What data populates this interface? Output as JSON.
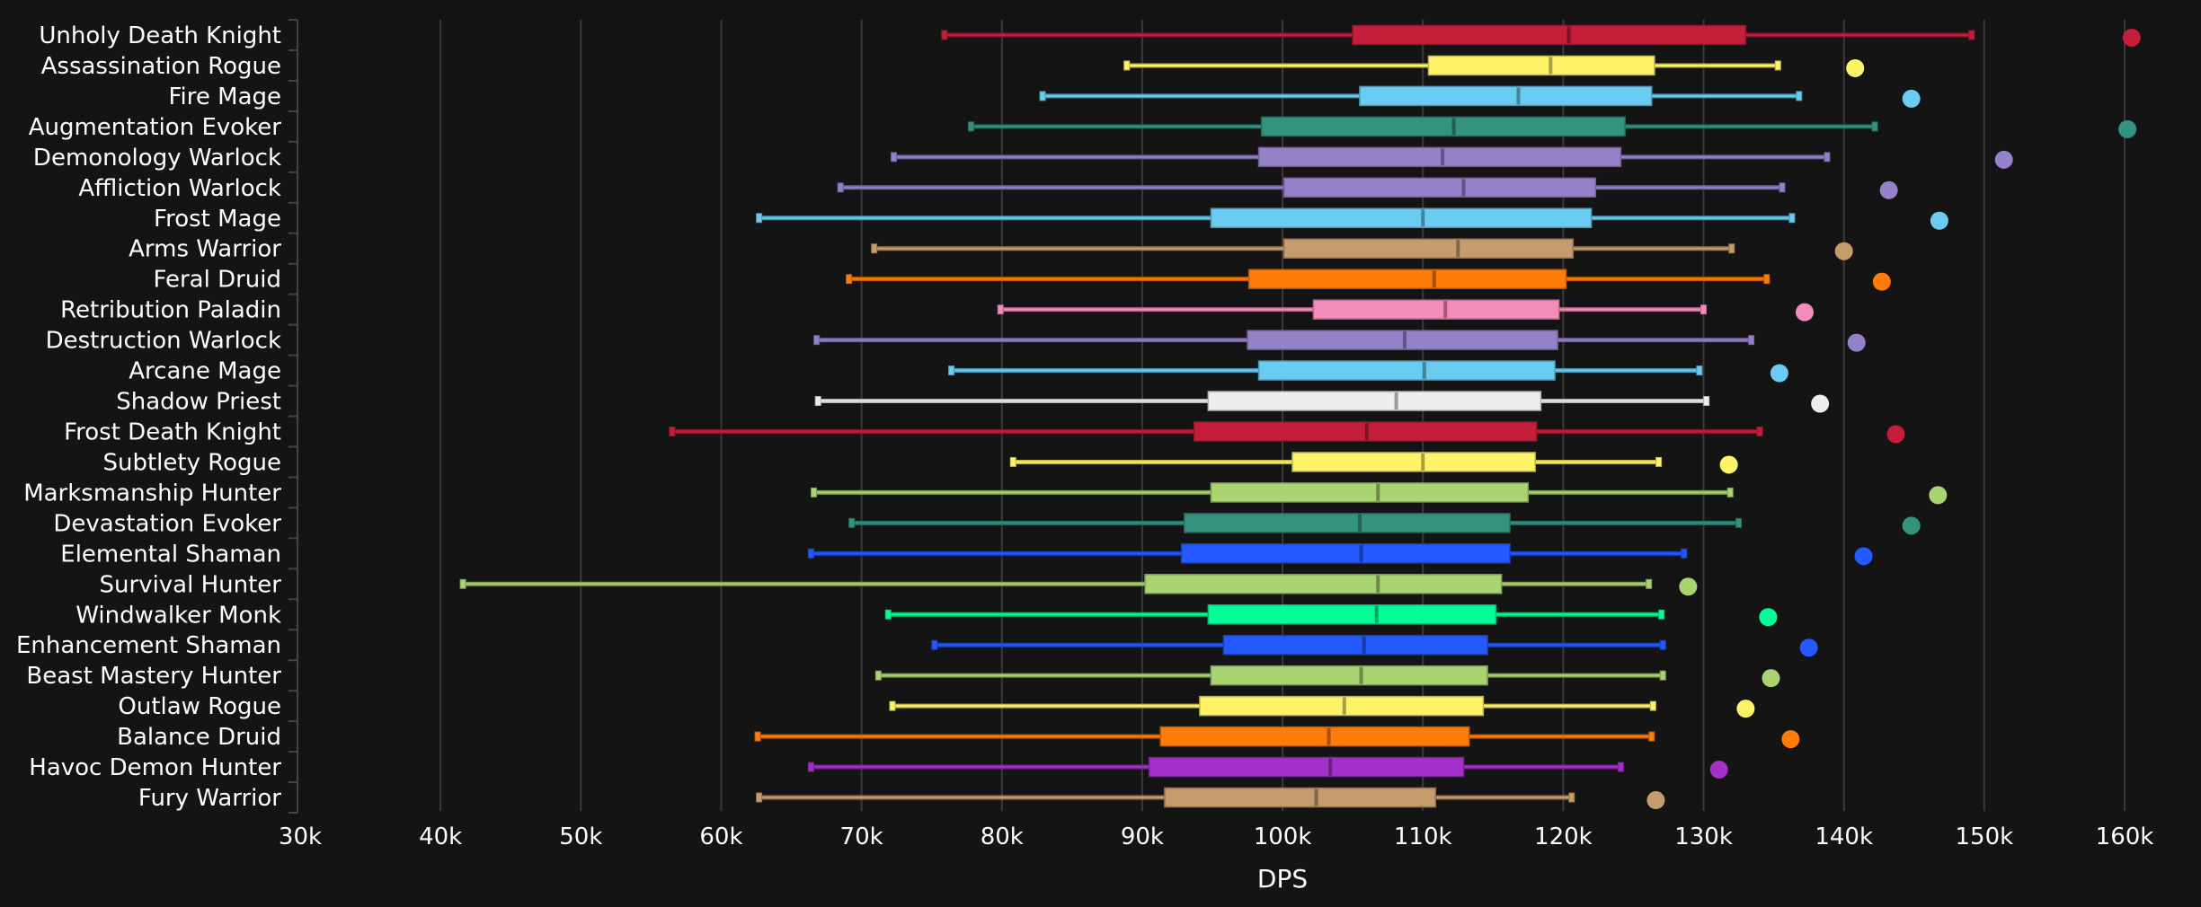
{
  "chart_data": {
    "type": "boxplot",
    "title": "",
    "xlabel": "DPS",
    "ylabel": "",
    "xlim": [
      30000,
      160000
    ],
    "x_ticks": [
      30000,
      40000,
      50000,
      60000,
      70000,
      80000,
      90000,
      100000,
      110000,
      120000,
      130000,
      140000,
      150000,
      160000
    ],
    "x_tick_labels": [
      "30k",
      "40k",
      "50k",
      "60k",
      "70k",
      "80k",
      "90k",
      "100k",
      "110k",
      "120k",
      "130k",
      "140k",
      "150k",
      "160k"
    ],
    "grid": "vertical",
    "legend": "none",
    "series": [
      {
        "name": "Unholy Death Knight",
        "color": "#C41E3A",
        "whisker_low": 75900,
        "q1": 105000,
        "median": 120400,
        "q3": 133000,
        "whisker_high": 149100,
        "outlier": 160500
      },
      {
        "name": "Assassination Rogue",
        "color": "#FFF468",
        "whisker_low": 88900,
        "q1": 110400,
        "median": 119100,
        "q3": 126500,
        "whisker_high": 135300,
        "outlier": 140800
      },
      {
        "name": "Fire Mage",
        "color": "#69CCF0",
        "whisker_low": 82900,
        "q1": 105500,
        "median": 116800,
        "q3": 126300,
        "whisker_high": 136800,
        "outlier": 144800
      },
      {
        "name": "Augmentation Evoker",
        "color": "#33937F",
        "whisker_low": 77800,
        "q1": 98500,
        "median": 112200,
        "q3": 124400,
        "whisker_high": 142200,
        "outlier": 160200
      },
      {
        "name": "Demonology Warlock",
        "color": "#9482C9",
        "whisker_low": 72300,
        "q1": 98300,
        "median": 111400,
        "q3": 124100,
        "whisker_high": 138800,
        "outlier": 151400
      },
      {
        "name": "Affliction Warlock",
        "color": "#9482C9",
        "whisker_low": 68500,
        "q1": 100100,
        "median": 112900,
        "q3": 122300,
        "whisker_high": 135600,
        "outlier": 143200
      },
      {
        "name": "Frost Mage",
        "color": "#69CCF0",
        "whisker_low": 62700,
        "q1": 94900,
        "median": 110000,
        "q3": 122000,
        "whisker_high": 136300,
        "outlier": 146800
      },
      {
        "name": "Arms Warrior",
        "color": "#C69B6D",
        "whisker_low": 70900,
        "q1": 100100,
        "median": 112500,
        "q3": 120700,
        "whisker_high": 132000,
        "outlier": 140000
      },
      {
        "name": "Feral Druid",
        "color": "#FF7C0A",
        "whisker_low": 69100,
        "q1": 97600,
        "median": 110800,
        "q3": 120200,
        "whisker_high": 134500,
        "outlier": 142700
      },
      {
        "name": "Retribution Paladin",
        "color": "#F48CBA",
        "whisker_low": 79900,
        "q1": 102200,
        "median": 111600,
        "q3": 119700,
        "whisker_high": 130000,
        "outlier": 137200
      },
      {
        "name": "Destruction Warlock",
        "color": "#9482C9",
        "whisker_low": 66800,
        "q1": 97500,
        "median": 108700,
        "q3": 119600,
        "whisker_high": 133400,
        "outlier": 140900
      },
      {
        "name": "Arcane Mage",
        "color": "#69CCF0",
        "whisker_low": 76400,
        "q1": 98300,
        "median": 110100,
        "q3": 119400,
        "whisker_high": 129700,
        "outlier": 135400
      },
      {
        "name": "Shadow Priest",
        "color": "#EEEEEE",
        "whisker_low": 66900,
        "q1": 94700,
        "median": 108100,
        "q3": 118400,
        "whisker_high": 130200,
        "outlier": 138300
      },
      {
        "name": "Frost Death Knight",
        "color": "#C41E3A",
        "whisker_low": 56500,
        "q1": 93700,
        "median": 106000,
        "q3": 118100,
        "whisker_high": 134000,
        "outlier": 143700
      },
      {
        "name": "Subtlety Rogue",
        "color": "#FFF468",
        "whisker_low": 80800,
        "q1": 100700,
        "median": 110000,
        "q3": 118000,
        "whisker_high": 126800,
        "outlier": 131800
      },
      {
        "name": "Marksmanship Hunter",
        "color": "#AAD372",
        "whisker_low": 66600,
        "q1": 94900,
        "median": 106800,
        "q3": 117500,
        "whisker_high": 131900,
        "outlier": 146700
      },
      {
        "name": "Devastation Evoker",
        "color": "#33937F",
        "whisker_low": 69300,
        "q1": 93000,
        "median": 105500,
        "q3": 116200,
        "whisker_high": 132500,
        "outlier": 144800
      },
      {
        "name": "Elemental Shaman",
        "color": "#2359FF",
        "whisker_low": 66400,
        "q1": 92800,
        "median": 105600,
        "q3": 116200,
        "whisker_high": 128600,
        "outlier": 141400
      },
      {
        "name": "Survival Hunter",
        "color": "#AAD372",
        "whisker_low": 41600,
        "q1": 90200,
        "median": 106800,
        "q3": 115600,
        "whisker_high": 126100,
        "outlier": 128900
      },
      {
        "name": "Windwalker Monk",
        "color": "#00FF98",
        "whisker_low": 71900,
        "q1": 94700,
        "median": 106700,
        "q3": 115200,
        "whisker_high": 127000,
        "outlier": 134600
      },
      {
        "name": "Enhancement Shaman",
        "color": "#2359FF",
        "whisker_low": 75200,
        "q1": 95800,
        "median": 105800,
        "q3": 114600,
        "whisker_high": 127100,
        "outlier": 137500
      },
      {
        "name": "Beast Mastery Hunter",
        "color": "#AAD372",
        "whisker_low": 71200,
        "q1": 94900,
        "median": 105600,
        "q3": 114600,
        "whisker_high": 127100,
        "outlier": 134800
      },
      {
        "name": "Outlaw Rogue",
        "color": "#FFF468",
        "whisker_low": 72200,
        "q1": 94100,
        "median": 104400,
        "q3": 114300,
        "whisker_high": 126400,
        "outlier": 133000
      },
      {
        "name": "Balance Druid",
        "color": "#FF7C0A",
        "whisker_low": 62600,
        "q1": 91300,
        "median": 103300,
        "q3": 113300,
        "whisker_high": 126300,
        "outlier": 136200
      },
      {
        "name": "Havoc Demon Hunter",
        "color": "#A330C9",
        "whisker_low": 66400,
        "q1": 90500,
        "median": 103400,
        "q3": 112900,
        "whisker_high": 124100,
        "outlier": 131100
      },
      {
        "name": "Fury Warrior",
        "color": "#C69B6D",
        "whisker_low": 62700,
        "q1": 91600,
        "median": 102400,
        "q3": 110900,
        "whisker_high": 120600,
        "outlier": 126600
      }
    ]
  },
  "colors": {
    "background": "#141414",
    "gridline": "#3a3a3a",
    "axis": "#444444",
    "text": "#ffffff"
  }
}
